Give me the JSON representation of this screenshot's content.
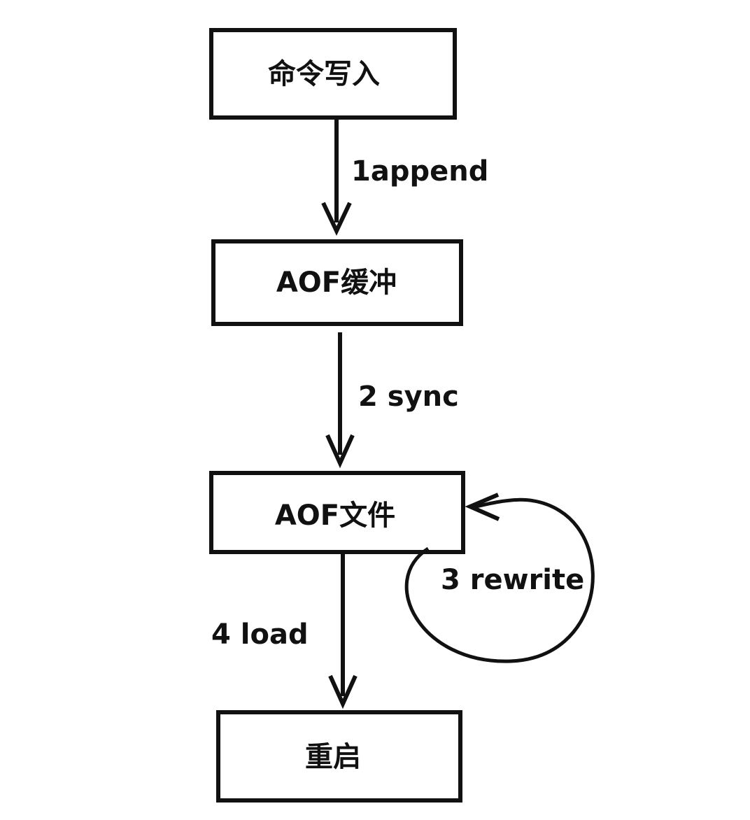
{
  "nodes": {
    "command_write": "命令写入",
    "aof_buffer": "AOF缓冲",
    "aof_file": "AOF文件",
    "restart": "重启"
  },
  "edges": {
    "append": "1append",
    "sync": "2 sync",
    "rewrite": "3 rewrite",
    "load": "4 load"
  },
  "colors": {
    "stroke": "#111111",
    "background": "#ffffff"
  }
}
